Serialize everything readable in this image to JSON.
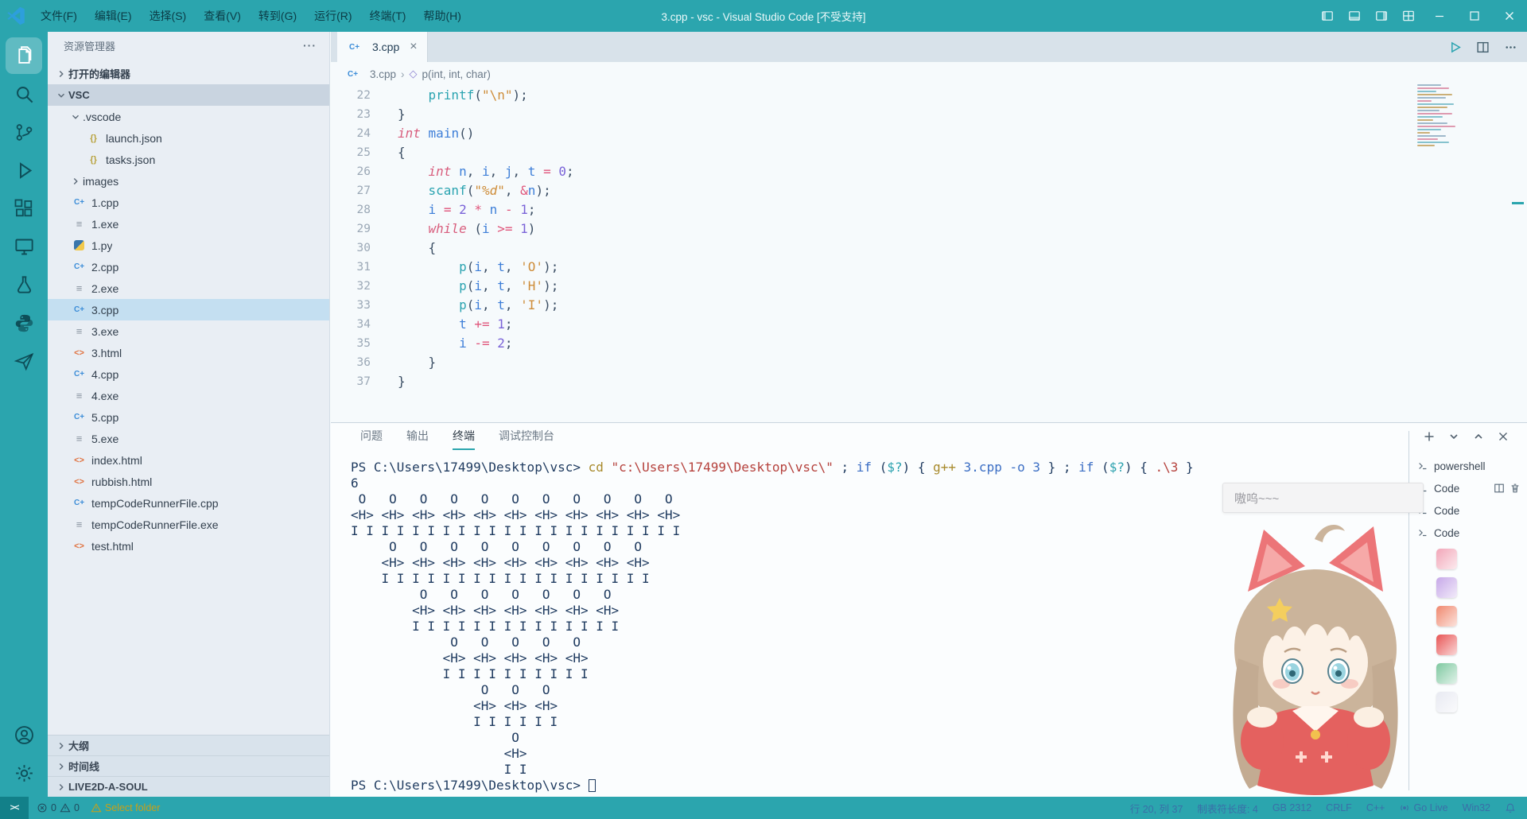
{
  "window": {
    "title": "3.cpp - vsc - Visual Studio Code [不受支持]",
    "menu": [
      "文件(F)",
      "编辑(E)",
      "选择(S)",
      "查看(V)",
      "转到(G)",
      "运行(R)",
      "终端(T)",
      "帮助(H)"
    ]
  },
  "activity_bar": {
    "items": [
      {
        "name": "explorer",
        "active": true
      },
      {
        "name": "search",
        "active": false
      },
      {
        "name": "source-control",
        "active": false
      },
      {
        "name": "run-debug",
        "active": false
      },
      {
        "name": "extensions",
        "active": false
      },
      {
        "name": "remote-explorer",
        "active": false
      },
      {
        "name": "testing",
        "active": false
      },
      {
        "name": "python",
        "active": false
      },
      {
        "name": "live2d",
        "active": false
      }
    ],
    "bottom": [
      {
        "name": "account"
      },
      {
        "name": "settings"
      }
    ]
  },
  "sidebar": {
    "title": "资源管理器",
    "more_label": "···",
    "tree": [
      {
        "label": "打开的编辑器",
        "indent": 0,
        "arrow": "collapsed",
        "header": true
      },
      {
        "label": "VSC",
        "indent": 0,
        "arrow": "expanded",
        "header": true,
        "state": "focus"
      },
      {
        "label": ".vscode",
        "indent": 1,
        "arrow": "expanded"
      },
      {
        "label": "launch.json",
        "indent": 2,
        "icon": "json"
      },
      {
        "label": "tasks.json",
        "indent": 2,
        "icon": "json"
      },
      {
        "label": "images",
        "indent": 1,
        "arrow": "collapsed"
      },
      {
        "label": "1.cpp",
        "indent": 1,
        "icon": "cpp"
      },
      {
        "label": "1.exe",
        "indent": 1,
        "icon": "exe"
      },
      {
        "label": "1.py",
        "indent": 1,
        "icon": "py"
      },
      {
        "label": "2.cpp",
        "indent": 1,
        "icon": "cpp"
      },
      {
        "label": "2.exe",
        "indent": 1,
        "icon": "exe"
      },
      {
        "label": "3.cpp",
        "indent": 1,
        "icon": "cpp",
        "state": "selected"
      },
      {
        "label": "3.exe",
        "indent": 1,
        "icon": "exe"
      },
      {
        "label": "3.html",
        "indent": 1,
        "icon": "html"
      },
      {
        "label": "4.cpp",
        "indent": 1,
        "icon": "cpp"
      },
      {
        "label": "4.exe",
        "indent": 1,
        "icon": "exe"
      },
      {
        "label": "5.cpp",
        "indent": 1,
        "icon": "cpp"
      },
      {
        "label": "5.exe",
        "indent": 1,
        "icon": "exe"
      },
      {
        "label": "index.html",
        "indent": 1,
        "icon": "html"
      },
      {
        "label": "rubbish.html",
        "indent": 1,
        "icon": "html"
      },
      {
        "label": "tempCodeRunnerFile.cpp",
        "indent": 1,
        "icon": "cpp"
      },
      {
        "label": "tempCodeRunnerFile.exe",
        "indent": 1,
        "icon": "exe"
      },
      {
        "label": "test.html",
        "indent": 1,
        "icon": "html"
      }
    ],
    "bottom_sections": [
      "大纲",
      "时间线",
      "LIVE2D-A-SOUL"
    ]
  },
  "editor": {
    "tab": {
      "label": "3.cpp"
    },
    "breadcrumb": {
      "file": "3.cpp",
      "separator": "›",
      "symbol": "p(int, int, char)",
      "symbol_glyph": "◇"
    },
    "code": {
      "first_line": 22,
      "lines": [
        [
          [
            "    ",
            "p"
          ],
          [
            "printf",
            "f"
          ],
          [
            "(",
            "p"
          ],
          [
            "\"\\n\"",
            "s"
          ],
          [
            ")",
            "p"
          ],
          [
            ";",
            "p"
          ]
        ],
        [
          [
            "}",
            "p"
          ]
        ],
        [
          [
            "int",
            "k"
          ],
          [
            " ",
            "p"
          ],
          [
            "main",
            "v"
          ],
          [
            "()",
            "p"
          ]
        ],
        [
          [
            "{",
            "p"
          ]
        ],
        [
          [
            "    ",
            "p"
          ],
          [
            "int",
            "k"
          ],
          [
            " ",
            "p"
          ],
          [
            "n",
            "v"
          ],
          [
            ", ",
            "p"
          ],
          [
            "i",
            "v"
          ],
          [
            ", ",
            "p"
          ],
          [
            "j",
            "v"
          ],
          [
            ", ",
            "p"
          ],
          [
            "t",
            "v"
          ],
          [
            " ",
            "p"
          ],
          [
            "=",
            "o"
          ],
          [
            " ",
            "p"
          ],
          [
            "0",
            "n"
          ],
          [
            ";",
            "p"
          ]
        ],
        [
          [
            "    ",
            "p"
          ],
          [
            "scanf",
            "f"
          ],
          [
            "(",
            "p"
          ],
          [
            "\"",
            "s"
          ],
          [
            "%d",
            "sf"
          ],
          [
            "\"",
            "s"
          ],
          [
            ", ",
            "p"
          ],
          [
            "&",
            "o"
          ],
          [
            "n",
            "v"
          ],
          [
            ")",
            "p"
          ],
          [
            ";",
            "p"
          ]
        ],
        [
          [
            "    ",
            "p"
          ],
          [
            "i",
            "v"
          ],
          [
            " ",
            "p"
          ],
          [
            "=",
            "o"
          ],
          [
            " ",
            "p"
          ],
          [
            "2",
            "n"
          ],
          [
            " ",
            "p"
          ],
          [
            "*",
            "o"
          ],
          [
            " ",
            "p"
          ],
          [
            "n",
            "v"
          ],
          [
            " ",
            "p"
          ],
          [
            "-",
            "o"
          ],
          [
            " ",
            "p"
          ],
          [
            "1",
            "n"
          ],
          [
            ";",
            "p"
          ]
        ],
        [
          [
            "    ",
            "p"
          ],
          [
            "while",
            "k"
          ],
          [
            " (",
            "p"
          ],
          [
            "i",
            "v"
          ],
          [
            " ",
            "p"
          ],
          [
            ">=",
            "o"
          ],
          [
            " ",
            "p"
          ],
          [
            "1",
            "n"
          ],
          [
            ")",
            "p"
          ]
        ],
        [
          [
            "    ",
            "p"
          ],
          [
            "{",
            "p"
          ]
        ],
        [
          [
            "        ",
            "p"
          ],
          [
            "p",
            "f"
          ],
          [
            "(",
            "p"
          ],
          [
            "i",
            "v"
          ],
          [
            ", ",
            "p"
          ],
          [
            "t",
            "v"
          ],
          [
            ", ",
            "p"
          ],
          [
            "'O'",
            "s"
          ],
          [
            ")",
            "p"
          ],
          [
            ";",
            "p"
          ]
        ],
        [
          [
            "        ",
            "p"
          ],
          [
            "p",
            "f"
          ],
          [
            "(",
            "p"
          ],
          [
            "i",
            "v"
          ],
          [
            ", ",
            "p"
          ],
          [
            "t",
            "v"
          ],
          [
            ", ",
            "p"
          ],
          [
            "'H'",
            "s"
          ],
          [
            ")",
            "p"
          ],
          [
            ";",
            "p"
          ]
        ],
        [
          [
            "        ",
            "p"
          ],
          [
            "p",
            "f"
          ],
          [
            "(",
            "p"
          ],
          [
            "i",
            "v"
          ],
          [
            ", ",
            "p"
          ],
          [
            "t",
            "v"
          ],
          [
            ", ",
            "p"
          ],
          [
            "'I'",
            "s"
          ],
          [
            ")",
            "p"
          ],
          [
            ";",
            "p"
          ]
        ],
        [
          [
            "        ",
            "p"
          ],
          [
            "t",
            "v"
          ],
          [
            " ",
            "p"
          ],
          [
            "+=",
            "o"
          ],
          [
            " ",
            "p"
          ],
          [
            "1",
            "n"
          ],
          [
            ";",
            "p"
          ]
        ],
        [
          [
            "        ",
            "p"
          ],
          [
            "i",
            "v"
          ],
          [
            " ",
            "p"
          ],
          [
            "-=",
            "o"
          ],
          [
            " ",
            "p"
          ],
          [
            "2",
            "n"
          ],
          [
            ";",
            "p"
          ]
        ],
        [
          [
            "    ",
            "p"
          ],
          [
            "}",
            "p"
          ]
        ],
        [
          [
            "}",
            "p"
          ]
        ]
      ]
    }
  },
  "panel": {
    "tabs": [
      {
        "label": "问题",
        "active": false
      },
      {
        "label": "输出",
        "active": false
      },
      {
        "label": "终端",
        "active": true
      },
      {
        "label": "调试控制台",
        "active": false
      }
    ],
    "terminal": {
      "lines": [
        {
          "tk": [
            [
              "PS C:\\Users\\17499\\Desktop\\vsc> ",
              "td"
            ],
            [
              "cd ",
              "tc"
            ],
            [
              "\"c:\\Users\\17499\\Desktop\\vsc\\\"",
              "ts"
            ],
            [
              " ; ",
              "td"
            ],
            [
              "if",
              "tk"
            ],
            [
              " (",
              "td"
            ],
            [
              "$?",
              "tv"
            ],
            [
              ") { ",
              "td"
            ],
            [
              "g++",
              "tc"
            ],
            [
              " 3.cpp -o 3 ",
              "ta"
            ],
            [
              "} ; ",
              "td"
            ],
            [
              "if",
              "tk"
            ],
            [
              " (",
              "td"
            ],
            [
              "$?",
              "tv"
            ],
            [
              ") { ",
              "td"
            ],
            [
              ".\\3",
              "ts"
            ],
            [
              " }",
              "td"
            ]
          ]
        },
        {
          "tk": [
            [
              "6",
              "td"
            ]
          ]
        },
        {
          "tk": [
            [
              " O   O   O   O   O   O   O   O   O   O   O",
              "td"
            ]
          ]
        },
        {
          "tk": [
            [
              "<H> <H> <H> <H> <H> <H> <H> <H> <H> <H> <H>",
              "td"
            ]
          ]
        },
        {
          "tk": [
            [
              "I I I I I I I I I I I I I I I I I I I I I I",
              "td"
            ]
          ]
        },
        {
          "tk": [
            [
              "     O   O   O   O   O   O   O   O   O",
              "td"
            ]
          ]
        },
        {
          "tk": [
            [
              "    <H> <H> <H> <H> <H> <H> <H> <H> <H>",
              "td"
            ]
          ]
        },
        {
          "tk": [
            [
              "    I I I I I I I I I I I I I I I I I I",
              "td"
            ]
          ]
        },
        {
          "tk": [
            [
              "         O   O   O   O   O   O   O",
              "td"
            ]
          ]
        },
        {
          "tk": [
            [
              "        <H> <H> <H> <H> <H> <H> <H>",
              "td"
            ]
          ]
        },
        {
          "tk": [
            [
              "        I I I I I I I I I I I I I I",
              "td"
            ]
          ]
        },
        {
          "tk": [
            [
              "             O   O   O   O   O",
              "td"
            ]
          ]
        },
        {
          "tk": [
            [
              "            <H> <H> <H> <H> <H>",
              "td"
            ]
          ]
        },
        {
          "tk": [
            [
              "            I I I I I I I I I I",
              "td"
            ]
          ]
        },
        {
          "tk": [
            [
              "                 O   O   O",
              "td"
            ]
          ]
        },
        {
          "tk": [
            [
              "                <H> <H> <H>",
              "td"
            ]
          ]
        },
        {
          "tk": [
            [
              "                I I I I I I",
              "td"
            ]
          ]
        },
        {
          "tk": [
            [
              "                     O",
              "td"
            ]
          ]
        },
        {
          "tk": [
            [
              "                    <H>",
              "td"
            ]
          ]
        },
        {
          "tk": [
            [
              "                    I I",
              "td"
            ]
          ]
        },
        {
          "tk": [
            [
              "PS C:\\Users\\17499\\Desktop\\vsc> ",
              "td"
            ]
          ],
          "cursor": true
        }
      ]
    },
    "terminal_tabs": [
      {
        "label": "powershell",
        "hover_actions": false
      },
      {
        "label": "Code",
        "hover_actions": true
      },
      {
        "label": "Code",
        "hover_actions": false
      },
      {
        "label": "Code",
        "hover_actions": false
      }
    ]
  },
  "status_bar": {
    "remote_label": "><",
    "errors": "0",
    "warnings": "0",
    "warning_item": "Select folder",
    "right": [
      {
        "label": "行 20, 列 37",
        "icon": ""
      },
      {
        "label": "制表符长度: 4",
        "icon": ""
      },
      {
        "label": "GB 2312",
        "icon": ""
      },
      {
        "label": "CRLF",
        "icon": ""
      },
      {
        "label": "C++",
        "icon": ""
      },
      {
        "label": "Go Live",
        "icon": "broadcast"
      },
      {
        "label": "Win32",
        "icon": ""
      },
      {
        "label": "",
        "icon": "bell"
      }
    ]
  },
  "overlay": {
    "bubble_text": "嗷呜~~~",
    "stickers": [
      "#F2A6B8",
      "#C6A8E8",
      "#F0886E",
      "#E85454",
      "#7EC8A0",
      "#E8EAF2"
    ]
  },
  "colors": {
    "chrome_teal": "#2BA5AE",
    "accent_teal": "#2AA3B0",
    "status_text_blue": "#3A6FA8",
    "warning_yellow": "#C8A018",
    "selection_blue": "#C4DFF1"
  }
}
